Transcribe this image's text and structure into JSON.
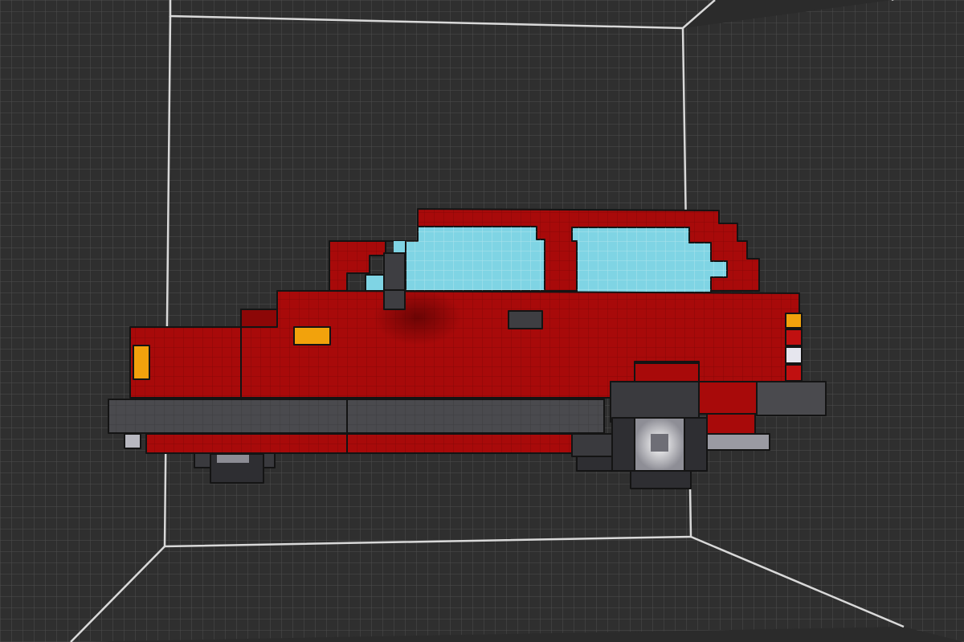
{
  "viewport": {
    "label": "",
    "background_color": "#2b2b2b",
    "grid_color": "#4d4d4d",
    "frame_color": "#d9d9d9"
  },
  "model": {
    "name": "",
    "body_color": "#a80a0a",
    "body_dark_color": "#8c0707",
    "glass_color": "#7fd4e4",
    "bumper_color": "#4a4a4e",
    "indicator_color": "#f2a20c",
    "light_color": "#e6e6ee",
    "tire_color": "#2e2e32"
  }
}
